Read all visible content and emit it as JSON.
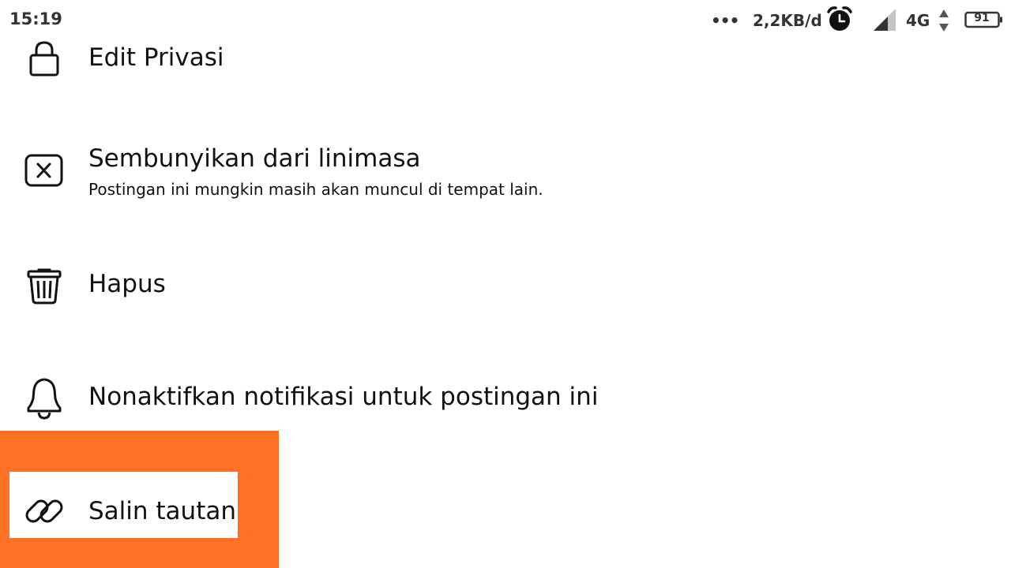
{
  "status_bar": {
    "time": "15:19",
    "more_indicator": "•••",
    "data_speed": "2,2KB/d",
    "network_type": "4G",
    "battery_level": "91",
    "icons": [
      "alarm-icon",
      "signal-icon",
      "data-arrows-icon",
      "battery-icon"
    ]
  },
  "menu": {
    "items": [
      {
        "label": "Edit Privasi",
        "icon": "lock-icon"
      },
      {
        "label": "Sembunyikan dari linimasa",
        "subtitle": "Postingan ini mungkin masih akan muncul di tempat lain.",
        "icon": "close-box-icon"
      },
      {
        "label": "Hapus",
        "icon": "trash-icon"
      },
      {
        "label": "Nonaktifkan notifikasi untuk postingan ini",
        "icon": "bell-icon"
      },
      {
        "label": "Salin tautan",
        "icon": "link-icon"
      }
    ]
  },
  "colors": {
    "highlight": "#FF7226",
    "text": "#111111",
    "status_text": "#333333"
  }
}
